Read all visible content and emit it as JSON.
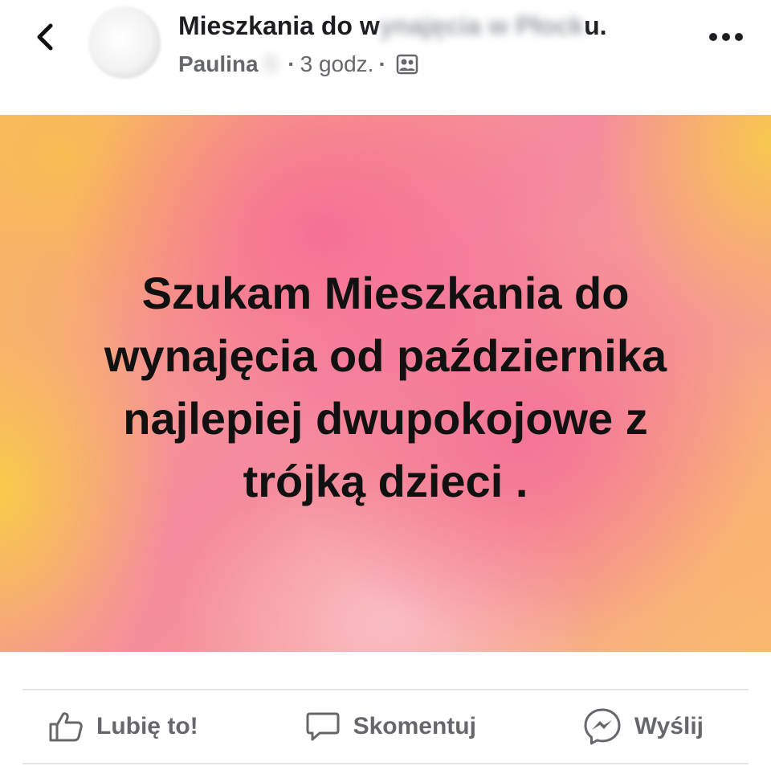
{
  "header": {
    "back_icon": "chevron-left-icon",
    "title_visible": "Mieszkania do w",
    "title_obscured": "ynajęcia w Płock",
    "title_end": "u.",
    "author": "Paulina",
    "author_obscured": "S",
    "time": "3 godz.",
    "separator": "·",
    "privacy_icon": "group-members-icon",
    "more_icon": "more-horizontal-icon"
  },
  "post": {
    "text": "Szukam Mieszkania do wynajęcia od października najlepiej dwupokojowe z trójką dzieci ."
  },
  "actions": {
    "like_label": "Lubię to!",
    "comment_label": "Skomentuj",
    "send_label": "Wyślij"
  },
  "colors": {
    "text_primary": "#1c1e21",
    "text_secondary": "#65676b",
    "divider": "#e4e6eb",
    "gradient_pink": "#f58aa0",
    "gradient_yellow": "#f8cd46"
  }
}
